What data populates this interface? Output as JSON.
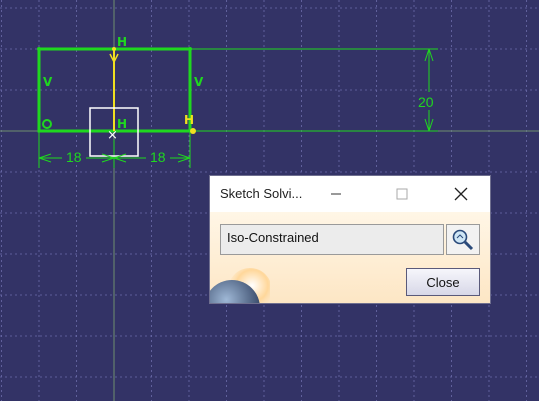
{
  "sketch": {
    "dim_left": "18",
    "dim_right": "18",
    "dim_vertical": "20",
    "constraint_h": "H",
    "constraint_v": "V",
    "constraint_coincident_label": ""
  },
  "dialog": {
    "title": "Sketch Solvi...",
    "status_text": "Iso-Constrained",
    "close_label": "Close"
  },
  "colors": {
    "background": "#333366",
    "geometry": "#1fd81f",
    "axis": "#f0e020",
    "grid": "#6b6bab"
  }
}
